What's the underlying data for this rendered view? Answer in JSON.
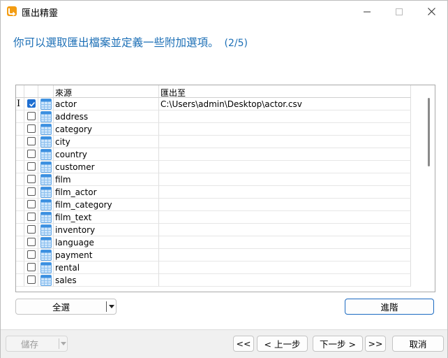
{
  "window": {
    "title": "匯出精靈",
    "heading": "你可以選取匯出檔案並定義一些附加選項。",
    "step": "(2/5)"
  },
  "grid": {
    "columns": {
      "source": "來源",
      "target": "匯出至"
    },
    "rows": [
      {
        "source": "actor",
        "target": "C:\\Users\\admin\\Desktop\\actor.csv",
        "checked": true,
        "current": true
      },
      {
        "source": "address",
        "target": "",
        "checked": false
      },
      {
        "source": "category",
        "target": "",
        "checked": false
      },
      {
        "source": "city",
        "target": "",
        "checked": false
      },
      {
        "source": "country",
        "target": "",
        "checked": false
      },
      {
        "source": "customer",
        "target": "",
        "checked": false
      },
      {
        "source": "film",
        "target": "",
        "checked": false
      },
      {
        "source": "film_actor",
        "target": "",
        "checked": false
      },
      {
        "source": "film_category",
        "target": "",
        "checked": false
      },
      {
        "source": "film_text",
        "target": "",
        "checked": false
      },
      {
        "source": "inventory",
        "target": "",
        "checked": false
      },
      {
        "source": "language",
        "target": "",
        "checked": false
      },
      {
        "source": "payment",
        "target": "",
        "checked": false
      },
      {
        "source": "rental",
        "target": "",
        "checked": false
      },
      {
        "source": "sales",
        "target": "",
        "checked": false
      }
    ]
  },
  "buttons": {
    "select_all": "全選",
    "advanced": "進階",
    "save": "儲存",
    "first": "<<",
    "prev": "< 上一步",
    "next": "下一步 >",
    "last": ">>",
    "cancel": "取消"
  },
  "icons": {
    "app": "export-wizard-icon",
    "table": "table-icon",
    "row_indicator": "text-cursor-icon"
  },
  "colors": {
    "accent": "#1c6fb6",
    "checkbox": "#1f6fd1",
    "primary_border": "#1b6ac2"
  }
}
